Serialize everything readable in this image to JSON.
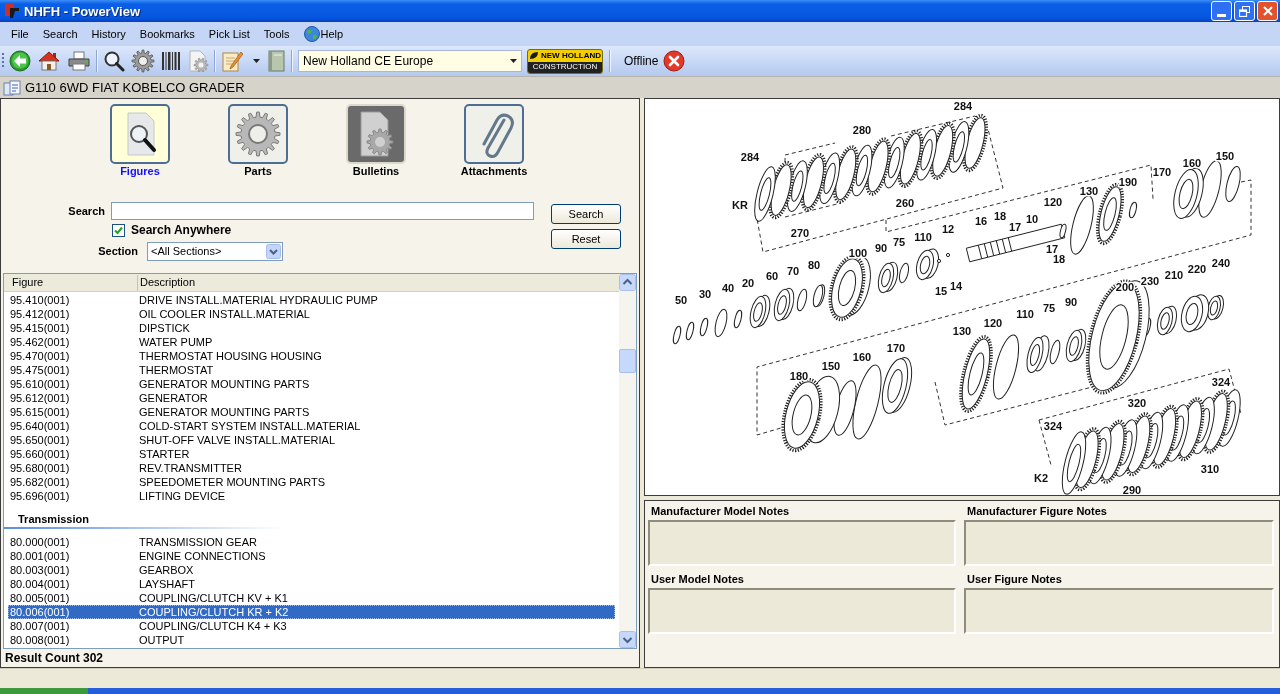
{
  "window": {
    "title": "NHFH - PowerView"
  },
  "menu": [
    {
      "label": "File",
      "kind": "plain"
    },
    {
      "label": "Search",
      "kind": "plain"
    },
    {
      "label": "History",
      "kind": "plain"
    },
    {
      "label": "Bookmarks",
      "kind": "plain"
    },
    {
      "label": "Pick List",
      "kind": "plain"
    },
    {
      "label": "Tools",
      "kind": "plain"
    },
    {
      "label": "Help",
      "kind": "globe"
    }
  ],
  "toolbar": {
    "groups": [
      [
        {
          "kind": "back"
        },
        {
          "kind": "home"
        },
        {
          "kind": "print"
        }
      ],
      [
        {
          "kind": "search"
        },
        {
          "kind": "gear"
        },
        {
          "kind": "barcode"
        },
        {
          "kind": "document_gear"
        }
      ],
      [
        {
          "kind": "notepad"
        },
        {
          "kind": "notebook"
        }
      ]
    ],
    "catalog": {
      "value": "New Holland CE Europe"
    },
    "logo": {
      "brand": "NEW HOLLAND",
      "division": "CONSTRUCTION"
    },
    "connection": {
      "label": "Offline"
    }
  },
  "model": {
    "title": "G110 6WD FIAT KOBELCO GRADER"
  },
  "views": [
    {
      "label": "Figures",
      "kind": "figures",
      "selected": true
    },
    {
      "label": "Parts",
      "kind": "parts",
      "selected": false
    },
    {
      "label": "Bulletins",
      "kind": "bulletins",
      "selected": false
    },
    {
      "label": "Attachments",
      "kind": "attachments",
      "selected": false
    }
  ],
  "search": {
    "label": "Search"
  },
  "search_anywhere": {
    "label": "Search Anywhere",
    "checked": true
  },
  "section": {
    "label": "Section",
    "value": "<All Sections>"
  },
  "buttons": [
    {
      "label": "Search"
    },
    {
      "label": "Reset"
    }
  ],
  "table": {
    "columns": [
      "Figure",
      "Description"
    ],
    "rows": [
      {
        "kind": "item",
        "figure": "95.410(001)",
        "description": "DRIVE INSTALL.MATERIAL HYDRAULIC PUMP",
        "selected": false
      },
      {
        "kind": "item",
        "figure": "95.412(001)",
        "description": "OIL COOLER INSTALL.MATERIAL",
        "selected": false
      },
      {
        "kind": "item",
        "figure": "95.415(001)",
        "description": "DIPSTICK",
        "selected": false
      },
      {
        "kind": "item",
        "figure": "95.462(001)",
        "description": "WATER PUMP",
        "selected": false
      },
      {
        "kind": "item",
        "figure": "95.470(001)",
        "description": "THERMOSTAT HOUSING HOUSING",
        "selected": false
      },
      {
        "kind": "item",
        "figure": "95.475(001)",
        "description": "THERMOSTAT",
        "selected": false
      },
      {
        "kind": "item",
        "figure": "95.610(001)",
        "description": "GENERATOR MOUNTING PARTS",
        "selected": false
      },
      {
        "kind": "item",
        "figure": "95.612(001)",
        "description": "GENERATOR",
        "selected": false
      },
      {
        "kind": "item",
        "figure": "95.615(001)",
        "description": "GENERATOR MOUNTING PARTS",
        "selected": false
      },
      {
        "kind": "item",
        "figure": "95.640(001)",
        "description": "COLD-START SYSTEM INSTALL.MATERIAL",
        "selected": false
      },
      {
        "kind": "item",
        "figure": "95.650(001)",
        "description": "SHUT-OFF VALVE INSTALL.MATERIAL",
        "selected": false
      },
      {
        "kind": "item",
        "figure": "95.660(001)",
        "description": "STARTER",
        "selected": false
      },
      {
        "kind": "item",
        "figure": "95.680(001)",
        "description": "REV.TRANSMITTER",
        "selected": false
      },
      {
        "kind": "item",
        "figure": "95.682(001)",
        "description": "SPEEDOMETER MOUNTING PARTS",
        "selected": false
      },
      {
        "kind": "item",
        "figure": "95.696(001)",
        "description": "LIFTING DEVICE",
        "selected": false
      },
      {
        "kind": "group",
        "title": "Transmission"
      },
      {
        "kind": "item",
        "figure": "80.000(001)",
        "description": "TRANSMISSION GEAR",
        "selected": false
      },
      {
        "kind": "item",
        "figure": "80.001(001)",
        "description": "ENGINE CONNECTIONS",
        "selected": false
      },
      {
        "kind": "item",
        "figure": "80.003(001)",
        "description": "GEARBOX",
        "selected": false
      },
      {
        "kind": "item",
        "figure": "80.004(001)",
        "description": "LAYSHAFT",
        "selected": false
      },
      {
        "kind": "item",
        "figure": "80.005(001)",
        "description": "COUPLING/CLUTCH KV + K1",
        "selected": false
      },
      {
        "kind": "item",
        "figure": "80.006(001)",
        "description": "COUPLING/CLUTCH KR + K2",
        "selected": true
      },
      {
        "kind": "item",
        "figure": "80.007(001)",
        "description": "COUPLING/CLUTCH K4 + K3",
        "selected": false
      },
      {
        "kind": "item",
        "figure": "80.008(001)",
        "description": "OUTPUT",
        "selected": false
      }
    ]
  },
  "result_count": "Result Count 302",
  "diagram": {
    "callouts": [
      "284",
      "280",
      "284",
      "160",
      "150",
      "170",
      "190",
      "130",
      "KR",
      "260",
      "120",
      "16",
      "18",
      "10",
      "270",
      "12",
      "17",
      "75",
      "110",
      "100",
      "90",
      "17",
      "80",
      "18",
      "240",
      "60",
      "70",
      "210",
      "220",
      "40",
      "20",
      "14",
      "200",
      "230",
      "30",
      "15",
      "50",
      "90",
      "75",
      "110",
      "120",
      "130",
      "170",
      "160",
      "150",
      "180",
      "324",
      "320",
      "324",
      "K2",
      "310",
      "290"
    ]
  },
  "notes": [
    {
      "label": "Manufacturer Model Notes"
    },
    {
      "label": "Manufacturer Figure Notes"
    },
    {
      "label": "User Model Notes"
    },
    {
      "label": "User Figure Notes"
    }
  ]
}
